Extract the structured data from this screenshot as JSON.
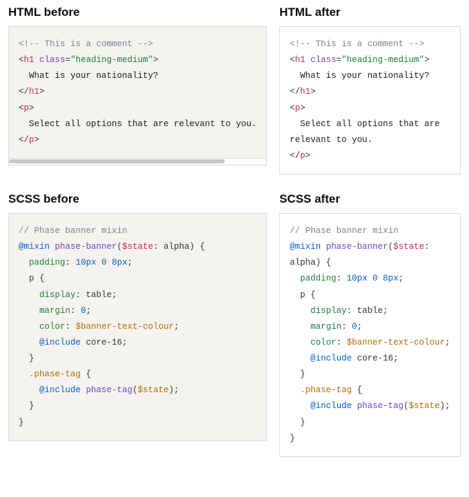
{
  "headings": {
    "html_before": "HTML before",
    "html_after": "HTML after",
    "scss_before": "SCSS before",
    "scss_after": "SCSS after"
  },
  "html_code": {
    "comment_open": "<!--",
    "comment_text": " This is a comment ",
    "comment_close": "-->",
    "lt": "<",
    "gt": ">",
    "slash": "/",
    "eq": "=",
    "h1": "h1",
    "p": "p",
    "class_attr": "class",
    "class_value": "\"heading-medium\"",
    "h1_text": "What is your nationality?",
    "p_text_before": "Select all options that are relevant to you.",
    "p_text_after": "Select all options that are relevant to you."
  },
  "scss_code": {
    "comment": "// Phase banner mixin",
    "at_mixin": "@mixin",
    "mixin_name": "phase-banner",
    "paren_open": "(",
    "paren_close": ")",
    "brace_open": "{",
    "brace_close": "}",
    "state_var": "$state",
    "colon": ":",
    "alpha": " alpha",
    "padding": "padding",
    "padding_val": "10px 0 8px",
    "semi": ";",
    "p_sel": "p",
    "display": "display",
    "display_val": " table",
    "margin": "margin",
    "margin_val": "0",
    "color": "color",
    "banner_var": "$banner-text-colour",
    "at_include": "@include",
    "core16": " core-16",
    "phase_tag_sel": ".phase-tag",
    "phase_tag_fn": "phase-tag"
  }
}
